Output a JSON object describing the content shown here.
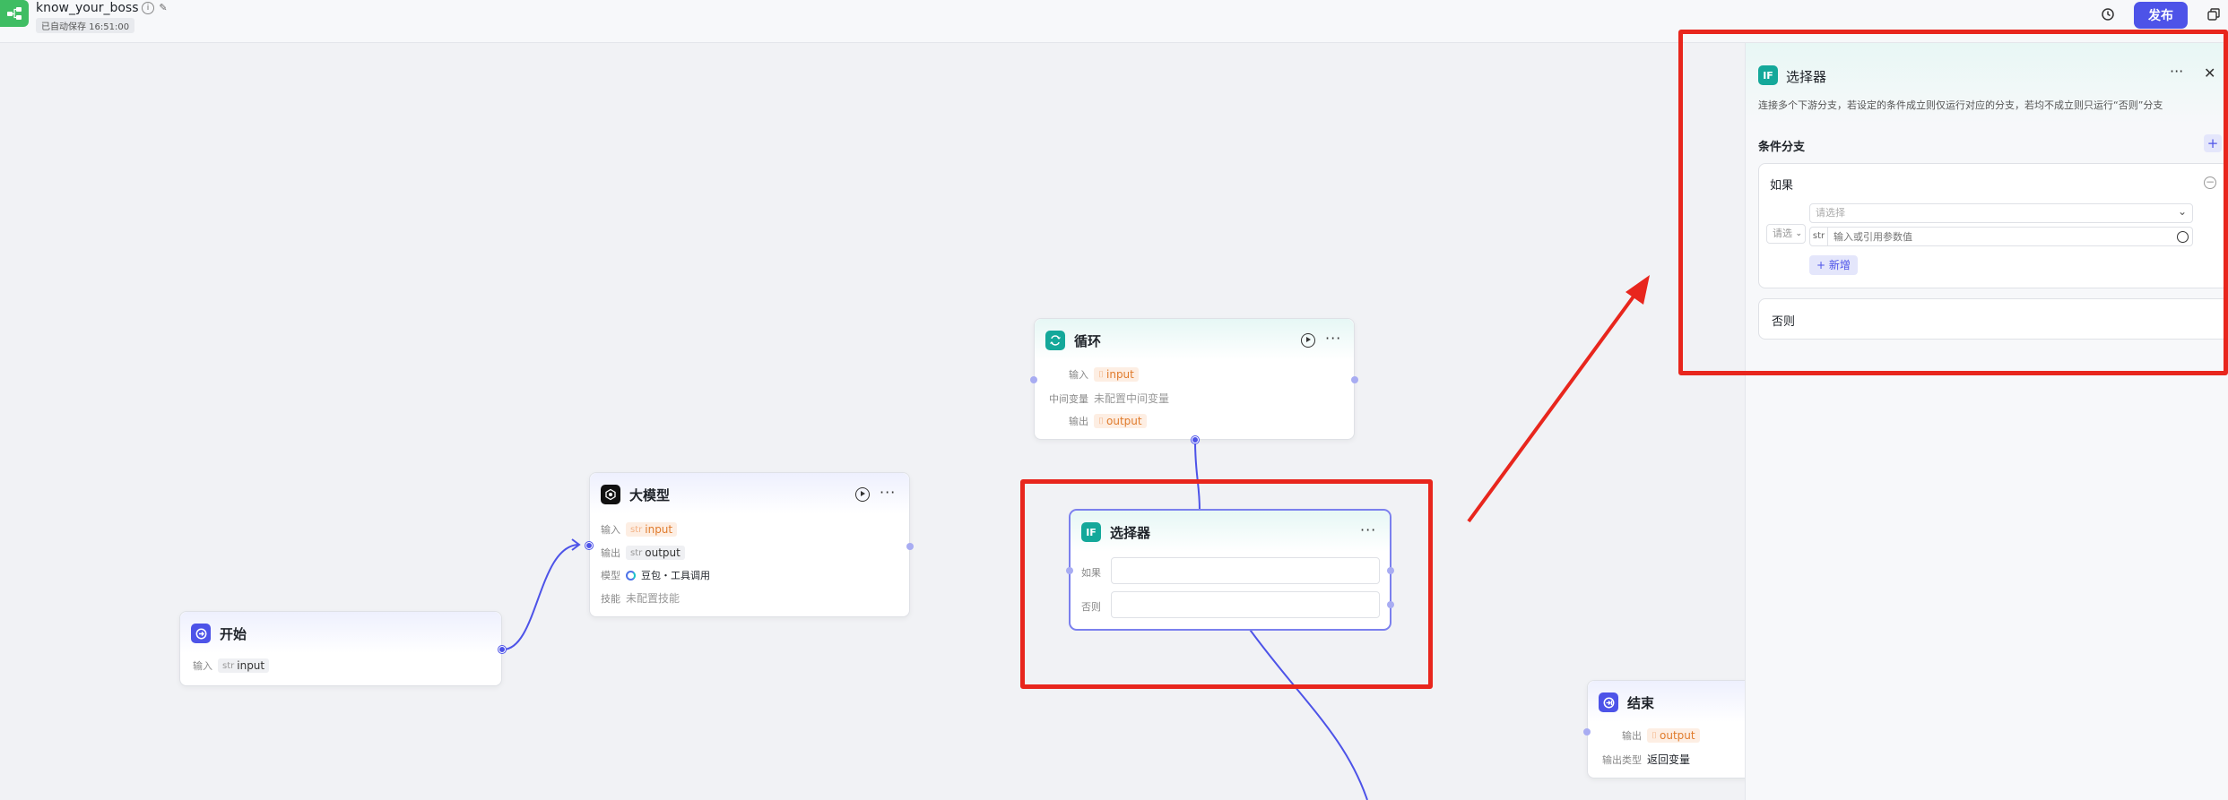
{
  "topbar": {
    "app_name": "know_your_boss",
    "autosave": "已自动保存 16:51:00",
    "publish_label": "发布"
  },
  "colors": {
    "accent": "#4d53e8",
    "annotation": "#e8261d",
    "teal": "#14a89a",
    "orange_tag": "#e07b2c"
  },
  "nodes": {
    "start": {
      "title": "开始",
      "input_label": "输入",
      "input_type": "str",
      "input_value": "input"
    },
    "llm": {
      "title": "大模型",
      "input_label": "输入",
      "input_type": "str",
      "input_value": "input",
      "output_label": "输出",
      "output_type": "str",
      "output_value": "output",
      "model_label": "模型",
      "model_value": "豆包・工具调用",
      "skill_label": "技能",
      "skill_value": "未配置技能"
    },
    "loop": {
      "title": "循环",
      "input_label": "输入",
      "input_value": "input",
      "var_label": "中间变量",
      "var_value": "未配置中间变量",
      "output_label": "输出",
      "output_value": "output"
    },
    "selector": {
      "title": "选择器",
      "if_label": "如果",
      "else_label": "否则"
    },
    "end": {
      "title": "结束",
      "output_label": "输出",
      "output_value": "output",
      "output_type_label": "输出类型",
      "output_type_value": "返回变量"
    }
  },
  "panel": {
    "title": "选择器",
    "description": "连接多个下游分支，若设定的条件成立则仅运行对应的分支，若均不成立则只运行“否则”分支",
    "section_title": "条件分支",
    "if_label": "如果",
    "operator_placeholder": "请选",
    "field_placeholder": "请选择",
    "value_type": "str",
    "value_placeholder": "输入或引用参数值",
    "add_label": "+ 新增",
    "else_label": "否则"
  }
}
